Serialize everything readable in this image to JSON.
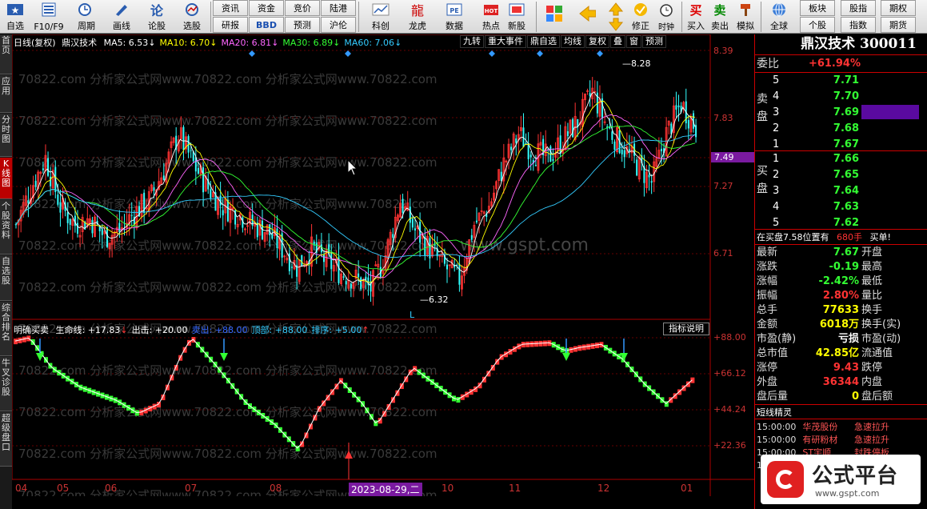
{
  "toolbar": {
    "buttons": [
      {
        "label": "自选",
        "icon": "star-icon"
      },
      {
        "label": "F10/F9",
        "icon": "document-icon"
      },
      {
        "label": "周期",
        "icon": "clock-icon"
      },
      {
        "label": "画线",
        "icon": "pen-icon"
      },
      {
        "label": "论股",
        "icon": "chat-icon"
      },
      {
        "label": "选股",
        "icon": "target-icon"
      }
    ],
    "grid": [
      [
        "资讯",
        "资金",
        "竞价",
        "陆港"
      ],
      [
        "研报",
        "BBD",
        "预测",
        "沪伦"
      ]
    ],
    "buttons2": [
      {
        "label": "科创",
        "icon": "chart-icon"
      },
      {
        "label": "龙虎",
        "icon": "dragon-icon"
      },
      {
        "label": "数据",
        "icon": "pe-icon"
      },
      {
        "label": "热点",
        "icon": "hot-icon"
      },
      {
        "label": "新股",
        "icon": "new-stock-icon"
      }
    ],
    "buttons3": [
      {
        "label": "",
        "icon": "grid-icon"
      },
      {
        "label": "",
        "icon": "arrow-left-icon"
      },
      {
        "label": "",
        "icon": "arrow-updown-icon"
      },
      {
        "label": "修正",
        "icon": "correct-icon"
      },
      {
        "label": "",
        "icon": "alarm-icon"
      }
    ],
    "trade": [
      {
        "label": "买入",
        "icon": "buy-icon",
        "glyph": "买"
      },
      {
        "label": "卖出",
        "icon": "sell-icon",
        "glyph": "卖"
      },
      {
        "label": "模拟",
        "icon": "hammer-icon",
        "glyph": ""
      }
    ],
    "global": {
      "label": "全球",
      "icon": "globe-icon"
    },
    "right_grid": [
      [
        "板块",
        "股指",
        "期权"
      ],
      [
        "个股",
        "指数",
        "期货"
      ]
    ]
  },
  "left_tabs": [
    "首页",
    "应用",
    "分时图",
    "K线图",
    "个股资料",
    "自选股",
    "综合排名",
    "牛叉诊股",
    "超级盘口"
  ],
  "chart_header": {
    "name": "日线(复权)",
    "stock": "鼎汉技术",
    "ma": [
      {
        "label": "MA5: 6.53",
        "arrow": "↓",
        "color": "#ffffff"
      },
      {
        "label": "MA10: 6.70",
        "arrow": "↓",
        "color": "#ffff00"
      },
      {
        "label": "MA20: 6.81",
        "arrow": "↓",
        "color": "#ff66ff"
      },
      {
        "label": "MA30: 6.89",
        "arrow": "↓",
        "color": "#33ff33"
      },
      {
        "label": "MA60: 7.06",
        "arrow": "↓",
        "color": "#33ccff"
      }
    ],
    "buttons": [
      "九转",
      "重大事件",
      "鼎自选",
      "均线",
      "复权",
      "叠",
      "窗",
      "预测"
    ],
    "high_label": "8.28",
    "low_label": "6.32",
    "low_marker": "L",
    "watermark": "70822.com 分析家公式网www.70822.com 分析家公式网www.70822.com",
    "watermark2": "www.gspt.com"
  },
  "price_axis": [
    "8.39",
    "7.83",
    "7.49",
    "7.27",
    "6.71"
  ],
  "indicator": {
    "title": "明确买卖",
    "items": [
      {
        "label": "生命线: +17.83",
        "arrow": "↓",
        "color": "#ffffff"
      },
      {
        "label": "出击: +20.00",
        "arrow": "",
        "color": "#ffffff"
      },
      {
        "label": "卖出: +88.00",
        "arrow": "",
        "color": "#3366ff"
      },
      {
        "label": "顶部: +88.00",
        "arrow": "",
        "color": "#33ccff"
      },
      {
        "label": "排序: +5.00",
        "arrow": "↑",
        "color": "#33ccff"
      }
    ],
    "explain": "指标说明",
    "axis": [
      "+88.00",
      "+66.12",
      "+44.24",
      "+22.36"
    ]
  },
  "months": [
    "04",
    "05",
    "06",
    "07",
    "08",
    "10",
    "11",
    "12",
    "01"
  ],
  "date_tag": "2023-08-29,二",
  "quote": {
    "title": "鼎汉技术 300011",
    "weibi_label": "委比",
    "weibi": "+61.94%",
    "sell_side_label": [
      "卖",
      "盘"
    ],
    "buy_side_label": [
      "买",
      "盘"
    ],
    "asks": [
      {
        "level": "5",
        "price": "7.71"
      },
      {
        "level": "4",
        "price": "7.70"
      },
      {
        "level": "3",
        "price": "7.69"
      },
      {
        "level": "2",
        "price": "7.68"
      },
      {
        "level": "1",
        "price": "7.67"
      }
    ],
    "bids": [
      {
        "level": "1",
        "price": "7.66"
      },
      {
        "level": "2",
        "price": "7.65"
      },
      {
        "level": "3",
        "price": "7.64"
      },
      {
        "level": "4",
        "price": "7.63"
      },
      {
        "level": "5",
        "price": "7.62"
      }
    ],
    "big_order": "在买盘7.58位置有",
    "big_order_qty": "680手",
    "big_order_tag": "买单!",
    "stats": [
      {
        "l": "最新",
        "v": "7.67",
        "c": "green",
        "r": "开盘"
      },
      {
        "l": "涨跌",
        "v": "-0.19",
        "c": "green",
        "r": "最高"
      },
      {
        "l": "涨幅",
        "v": "-2.42%",
        "c": "green",
        "r": "最低"
      },
      {
        "l": "振幅",
        "v": "2.80%",
        "c": "red",
        "r": "量比"
      },
      {
        "l": "总手",
        "v": "77633",
        "c": "yellow",
        "r": "换手"
      },
      {
        "l": "金额",
        "v": "6018万",
        "c": "yellow",
        "r": "换手(实)"
      },
      {
        "l": "市盈(静)",
        "v": "亏损",
        "c": "white",
        "r": "市盈(动)"
      },
      {
        "l": "总市值",
        "v": "42.85亿",
        "c": "yellow",
        "r": "流通值"
      },
      {
        "l": "涨停",
        "v": "9.43",
        "c": "red",
        "r": "跌停"
      },
      {
        "l": "外盘",
        "v": "36344",
        "c": "red",
        "r": "内盘"
      },
      {
        "l": "盘后量",
        "v": "0",
        "c": "yellow",
        "r": "盘后额"
      }
    ],
    "short_title": "短线精灵",
    "short_list": [
      {
        "time": "15:00:00",
        "name": "华茂股份",
        "event": "急速拉升"
      },
      {
        "time": "15:00:00",
        "name": "有研粉材",
        "event": "急速拉升"
      },
      {
        "time": "15:00:00",
        "name": "ST宇顺",
        "event": "封跌停板"
      },
      {
        "time": "15:00:00",
        "name": "",
        "event": ""
      }
    ]
  },
  "brand": {
    "name": "公式平台",
    "url": "www.gspt.com"
  },
  "colors": {
    "up": "#ff3333",
    "down": "#33ffff",
    "accent": "#cc0000"
  }
}
